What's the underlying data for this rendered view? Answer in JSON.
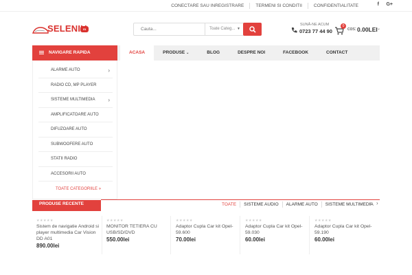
{
  "topbar": {
    "links": [
      "CONECTARE SAU INREGISTRARE",
      "TERMENI SI CONDITII",
      "CONFIDENTIALITATE"
    ],
    "social": [
      "f",
      "G+"
    ]
  },
  "logo": {
    "text": "SELENIU",
    "badge": "ro"
  },
  "search": {
    "placeholder": "Cauta...",
    "category": "Toate Categ..."
  },
  "phone": {
    "label": "SUNĂ-NE ACUM",
    "number": "0723 77 44 90"
  },
  "cart": {
    "count": "0",
    "label": "cos:",
    "total": "0.00LEI"
  },
  "nav": {
    "rapida": "NAVIGARE RAPIDA",
    "items": [
      "ACASA",
      "PRODUSE",
      "BLOG",
      "DESPRE NOI",
      "FACEBOOK",
      "CONTACT"
    ]
  },
  "sidebar": {
    "items": [
      "ALARME AUTO",
      "RADIO CD, MP PLAYER",
      "SISTEME MULTIMEDIA",
      "AMPLIFICATOARE AUTO",
      "DIFUZOARE AUTO",
      "SUBWOOFERE AUTO",
      "STATII RADIO",
      "ACCESORII AUTO"
    ],
    "all": "TOATE CATEGORIILE"
  },
  "recent": {
    "title": "PRODUSE RECENTE",
    "tabs": [
      "TOATE",
      "SISTEME AUDIO",
      "ALARME AUTO",
      "SISTEME MULTIMEDIA"
    ]
  },
  "products": [
    {
      "name": "Sistem de navigatie Android si player multimedia Car Vision DD A01",
      "price": "890.00lei"
    },
    {
      "name": "MONITOR TETIERA CU USB/SD/DVD",
      "price": "550.00lei"
    },
    {
      "name": "Adaptor Cupla Car kit Opel-59.600",
      "price": "70.00lei"
    },
    {
      "name": "Adaptor Cupla Car kit Opel-59.030",
      "price": "60.00lei"
    },
    {
      "name": "Adaptor Cupla Car kit Opel-59.190",
      "price": "60.00lei"
    }
  ],
  "colors": {
    "accent": "#e2413d"
  }
}
